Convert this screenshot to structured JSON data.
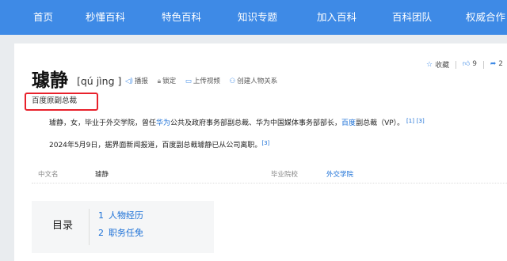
{
  "nav": [
    "首页",
    "秒懂百科",
    "特色百科",
    "知识专题",
    "加入百科",
    "百科团队",
    "权威合作"
  ],
  "entry": {
    "title": "璩静",
    "pinyin": "[qú jìng ]",
    "tools": {
      "play": "播报",
      "lock": "锁定",
      "upload": "上传视频",
      "relation": "创建人物关系"
    },
    "collect_label": "收藏",
    "like_count": "9",
    "share_count": "2",
    "subtitle": "百度原副总裁"
  },
  "summary": {
    "part1": "璩静，女，毕业于外交学院，曾任",
    "link1": "华为",
    "part2": "公共及政府事务部副总裁、华为中国媒体事务部部长，",
    "link2": "百度",
    "part3": "副总裁（VP）。",
    "ref1": "[1]",
    "ref2": "[3]"
  },
  "news": {
    "text": "2024年5月9日，据界面新闻报道，百度副总裁璩静已从公司离职。",
    "ref": "[3]"
  },
  "infobox": {
    "label1": "中文名",
    "value1": "璩静",
    "label2": "毕业院校",
    "value2": "外交学院"
  },
  "toc": {
    "title": "目录",
    "items": [
      {
        "num": "1",
        "label": "人物经历"
      },
      {
        "num": "2",
        "label": "职务任免"
      }
    ]
  },
  "colors": {
    "nav_bg": "#3e8ae6",
    "link": "#1a6fd6",
    "highlight_border": "#e8212b"
  }
}
